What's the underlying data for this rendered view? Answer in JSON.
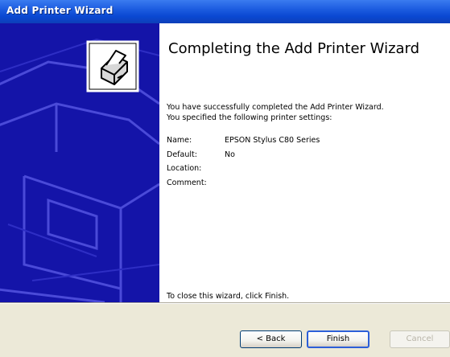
{
  "window": {
    "title": "Add Printer Wizard"
  },
  "content": {
    "heading": "Completing the Add Printer Wizard",
    "success_message": "You have successfully completed the Add Printer Wizard.",
    "settings_intro": "You specified the following printer settings:",
    "settings": [
      {
        "label": "Name:",
        "value": "EPSON Stylus C80 Series"
      },
      {
        "label": "Default:",
        "value": "No"
      },
      {
        "label": "Location:",
        "value": ""
      },
      {
        "label": "Comment:",
        "value": ""
      }
    ],
    "closing": "To close this wizard, click Finish."
  },
  "buttons": {
    "back": "< Back",
    "finish": "Finish",
    "cancel": "Cancel"
  },
  "icons": {
    "side_panel": "printer-wizard-icon",
    "watermark": "printer-watermark-icon"
  },
  "colors": {
    "titlebar": "#0a48d2",
    "side_panel": "#1414a8",
    "window_bg": "#ece9d8"
  }
}
